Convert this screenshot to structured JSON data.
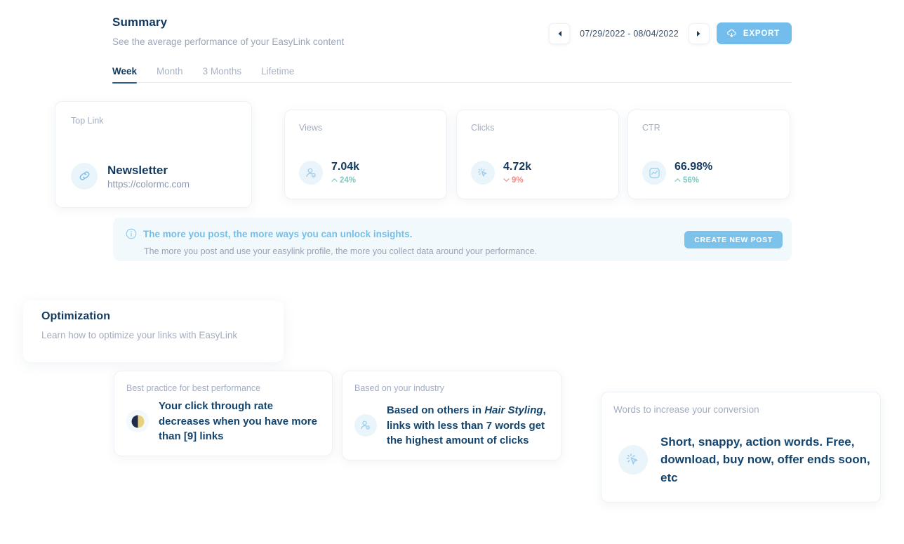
{
  "header": {
    "title": "Summary",
    "subtitle": "See the average performance of your EasyLink content",
    "date_range": "07/29/2022 - 08/04/2022",
    "prev_icon": "chevron-left-icon",
    "next_icon": "chevron-right-icon",
    "export_label": "EXPORT",
    "export_icon": "cloud-download-icon",
    "accent_color": "#73bdec"
  },
  "tabs": [
    {
      "label": "Week",
      "active": true
    },
    {
      "label": "Month",
      "active": false
    },
    {
      "label": "3 Months",
      "active": false
    },
    {
      "label": "Lifetime",
      "active": false
    }
  ],
  "top_link": {
    "label": "Top Link",
    "icon": "link-chain-icon",
    "name": "Newsletter",
    "url": "https://colormc.com"
  },
  "stats": [
    {
      "label": "Views",
      "icon": "person-badge-icon",
      "value": "7.04k",
      "delta": "24%",
      "delta_direction": "up",
      "delta_color": "#7ec9bf"
    },
    {
      "label": "Clicks",
      "icon": "cursor-click-icon",
      "value": "4.72k",
      "delta": "9%",
      "delta_direction": "down",
      "delta_color": "#f08b8b"
    },
    {
      "label": "CTR",
      "icon": "chart-line-square-icon",
      "value": "66.98%",
      "delta": "56%",
      "delta_direction": "up",
      "delta_color": "#7ec9bf"
    }
  ],
  "info_banner": {
    "icon": "info-circle-icon",
    "title": "The more you post, the more ways you can unlock insights.",
    "body": "The more you post and use your easylink profile, the more you collect data around your performance.",
    "cta_label": "CREATE NEW POST",
    "background": "#f2f9fd"
  },
  "optimization": {
    "title": "Optimization",
    "subtitle": "Learn how to optimize your links with EasyLink"
  },
  "tips": [
    {
      "label": "Best practice for best performance",
      "icon": "half-moon-icon",
      "text": "Your click through rate decreases when you have more than [9] links"
    },
    {
      "label": "Based on your industry",
      "icon": "person-badge-icon",
      "text_before": "Based on others in ",
      "text_italic": "Hair Styling",
      "text_after": ", links with less than 7 words get the highest amount of clicks"
    },
    {
      "label": "Words to increase your conversion",
      "icon": "cursor-click-icon",
      "text": "Short, snappy, action words. Free, download, buy now, offer ends soon, etc"
    }
  ]
}
